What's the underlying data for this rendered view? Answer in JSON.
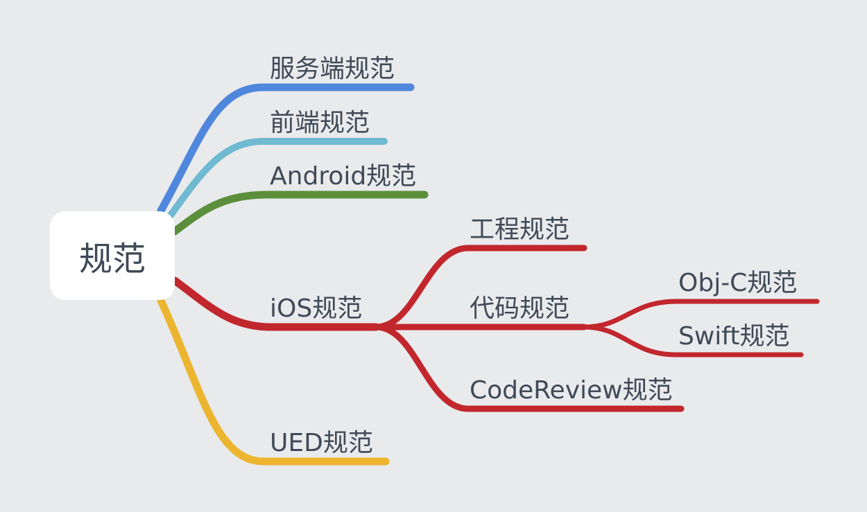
{
  "root": {
    "label": "规范"
  },
  "colors": {
    "background": "#e9eaec",
    "server": "#4f87dc",
    "frontend": "#6fb9d1",
    "android": "#5c8f3c",
    "ios": "#c1272d",
    "ued": "#ecb52f",
    "text": "#3f4a57"
  },
  "branches": {
    "server": {
      "label": "服务端规范"
    },
    "frontend": {
      "label": "前端规范"
    },
    "android": {
      "label": "Android规范"
    },
    "ios": {
      "label": "iOS规范",
      "children": {
        "engineering": {
          "label": "工程规范"
        },
        "code": {
          "label": "代码规范",
          "children": {
            "objc": {
              "label": "Obj-C规范"
            },
            "swift": {
              "label": "Swift规范"
            }
          }
        },
        "codereview": {
          "label": "CodeReview规范"
        }
      }
    },
    "ued": {
      "label": "UED规范"
    }
  }
}
